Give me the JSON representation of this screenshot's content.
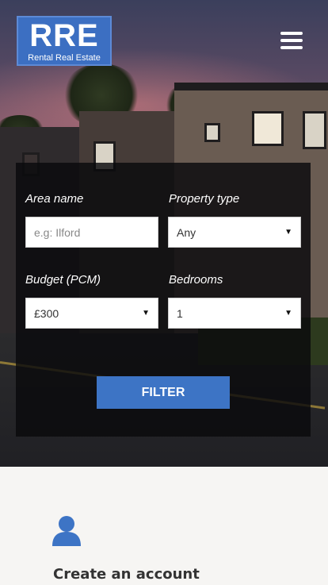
{
  "header": {
    "logo_big": "RRE",
    "logo_small": "Rental Real Estate"
  },
  "filter": {
    "area_label": "Area name",
    "area_placeholder": "e.g: Ilford",
    "type_label": "Property type",
    "type_value": "Any",
    "budget_label": "Budget (PCM)",
    "budget_value": "£300",
    "bedrooms_label": "Bedrooms",
    "bedrooms_value": "1",
    "button_label": "FILTER"
  },
  "account": {
    "title": "Create an account"
  },
  "colors": {
    "accent": "#3d74c5",
    "panel": "#0a0a0c"
  }
}
